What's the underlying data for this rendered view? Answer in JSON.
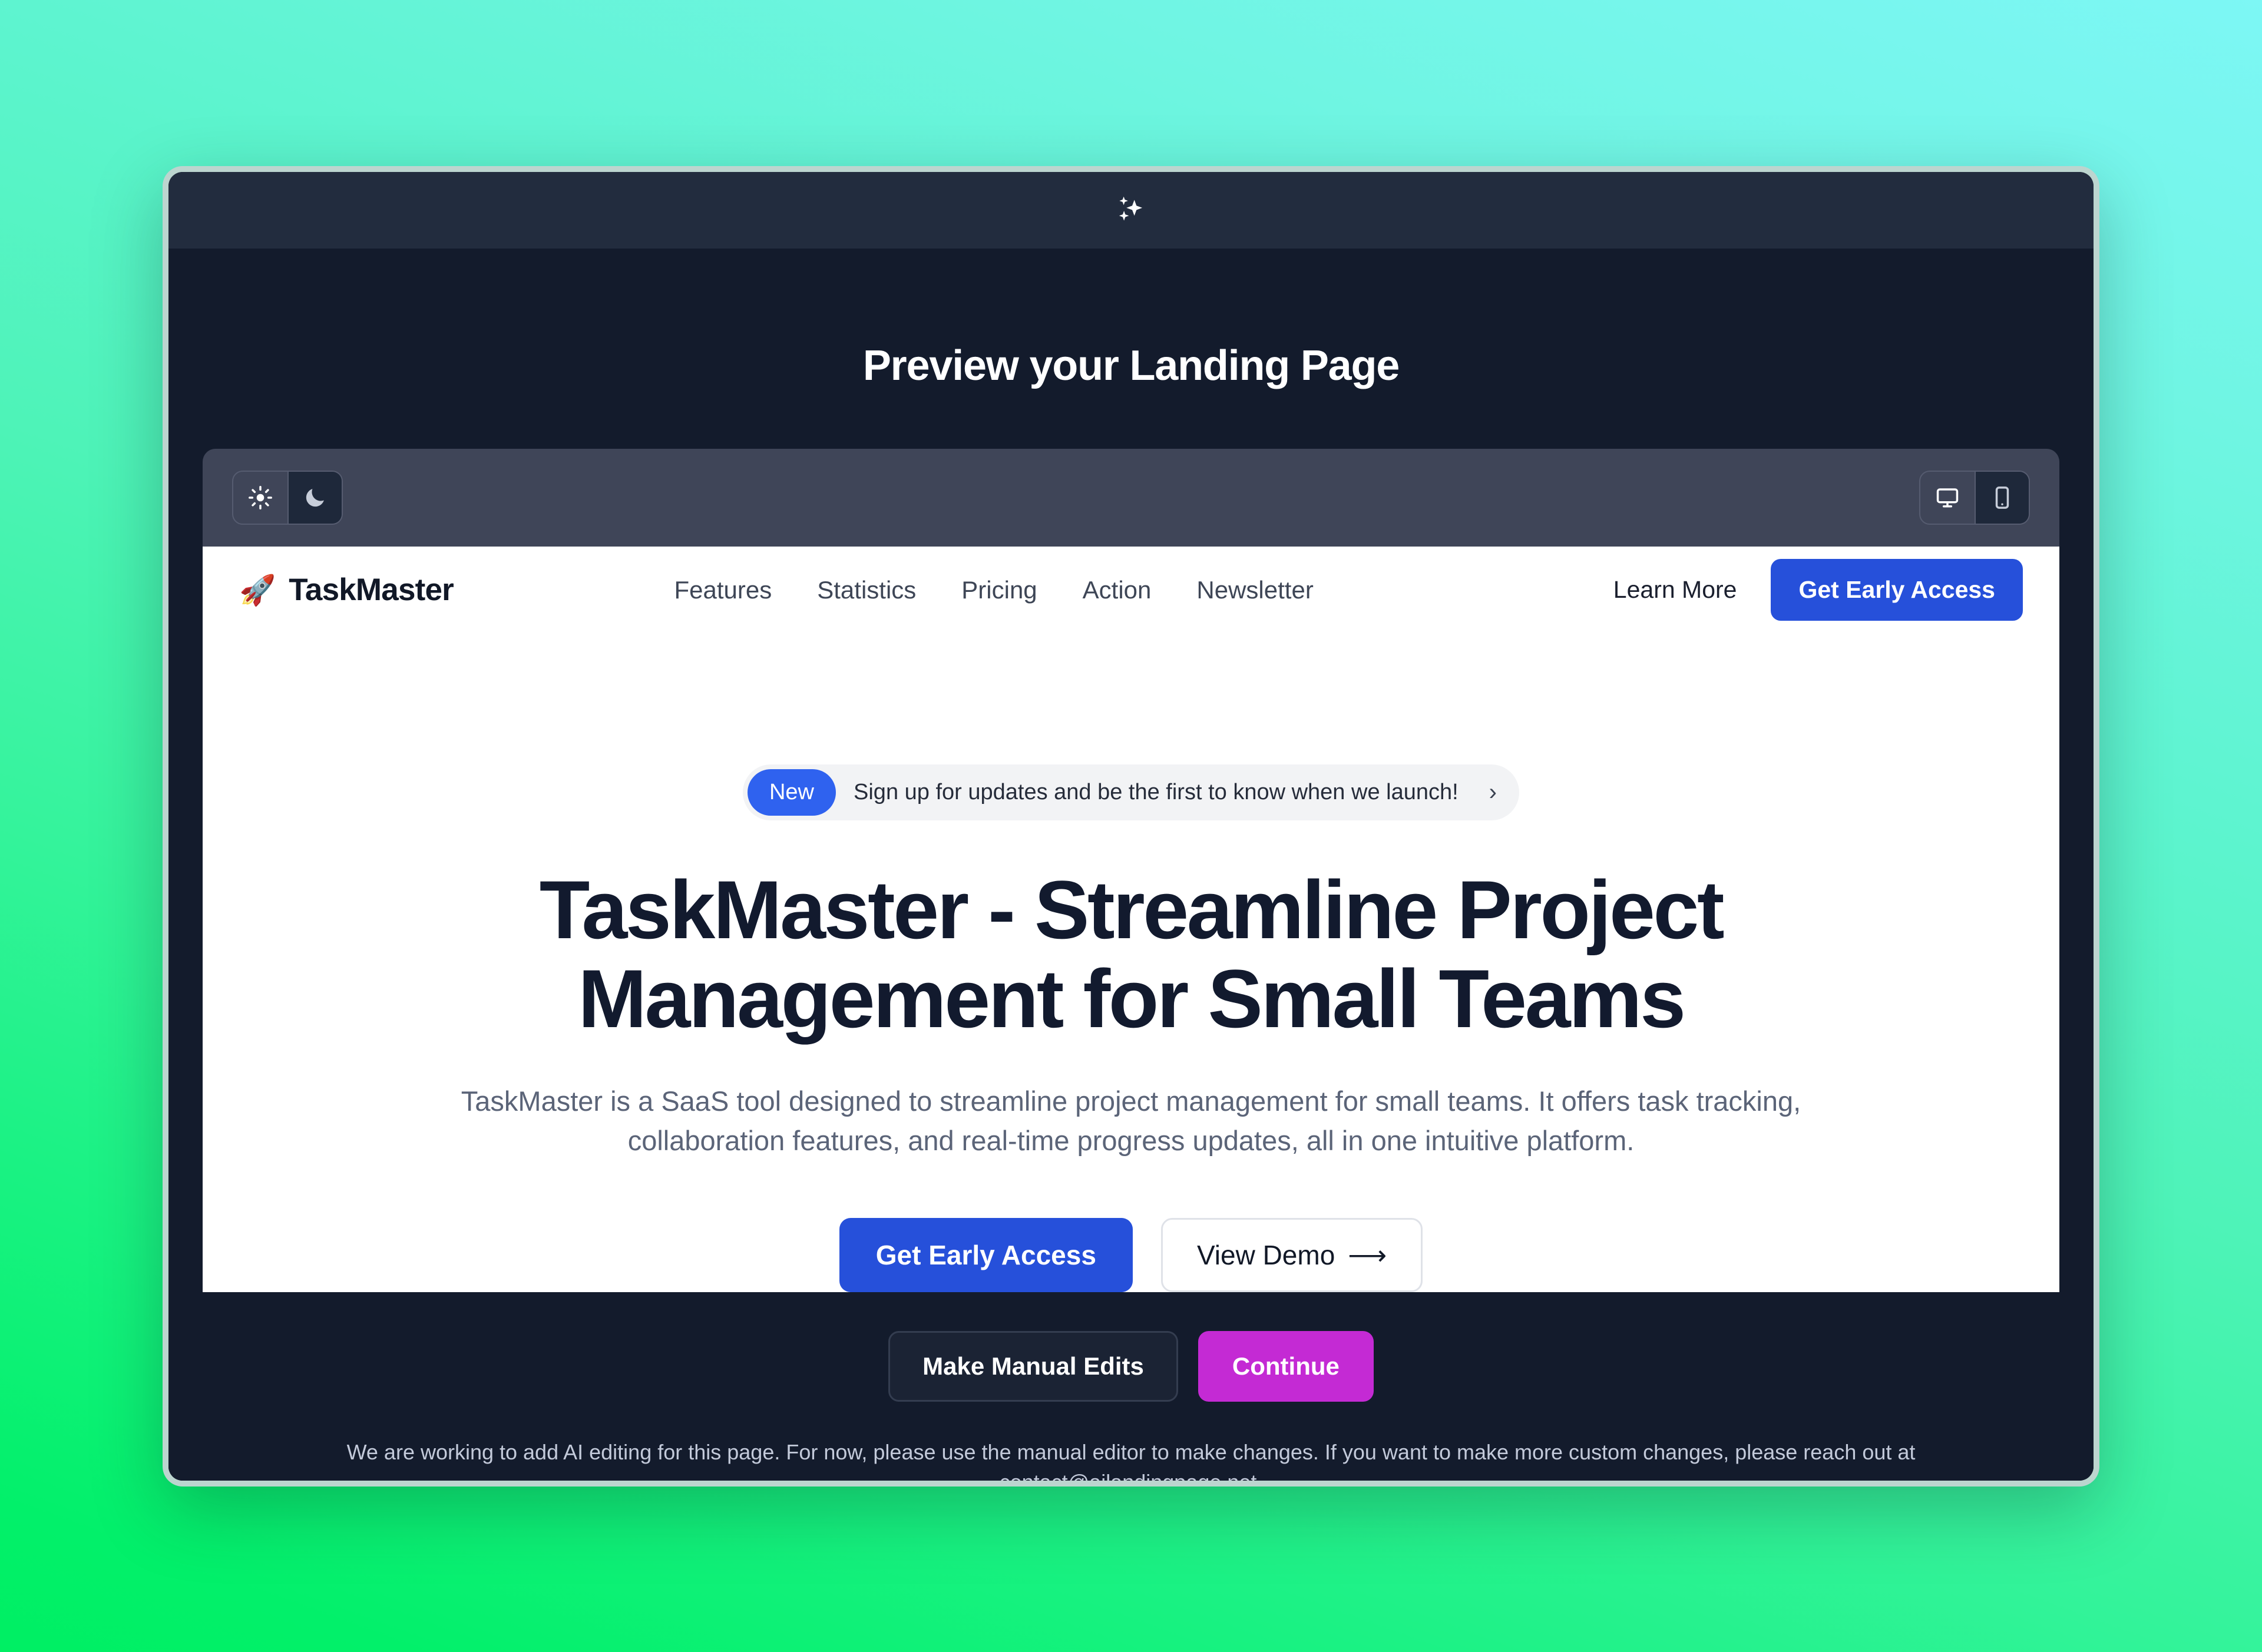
{
  "modal": {
    "header_icon": "sparkles-icon",
    "title": "Preview your Landing Page"
  },
  "preview_toolbar": {
    "theme_group": {
      "light": {
        "icon": "sun-icon",
        "label": "Light",
        "active": false
      },
      "dark": {
        "icon": "moon-icon",
        "label": "Dark",
        "active": true
      }
    },
    "device_group": {
      "desktop": {
        "icon": "monitor-icon",
        "label": "Desktop",
        "active": false
      },
      "mobile": {
        "icon": "mobile-icon",
        "label": "Mobile",
        "active": true
      }
    }
  },
  "landing": {
    "brand": {
      "logo_emoji": "🚀",
      "name": "TaskMaster"
    },
    "nav_links": [
      {
        "label": "Features"
      },
      {
        "label": "Statistics"
      },
      {
        "label": "Pricing"
      },
      {
        "label": "Action"
      },
      {
        "label": "Newsletter"
      }
    ],
    "nav_secondary_label": "Learn More",
    "nav_cta_label": "Get Early Access",
    "hero": {
      "badge_pill": "New",
      "badge_text": "Sign up for updates and be the first to know when we launch!",
      "badge_chevron": "›",
      "title": "TaskMaster - Streamline Project Management for Small Teams",
      "subtitle": "TaskMaster is a SaaS tool designed to streamline project management for small teams. It offers task tracking, collaboration features, and real-time progress updates, all in one intuitive platform.",
      "primary_cta": "Get Early Access",
      "secondary_cta": "View Demo",
      "secondary_cta_arrow": "⟶"
    }
  },
  "footer": {
    "manual_edits_label": "Make Manual Edits",
    "continue_label": "Continue",
    "note": "We are working to add AI editing for this page. For now, please use the manual editor to make changes. If you want to make more custom changes, please reach out at contact@ailandingpage.net."
  },
  "colors": {
    "accent_blue": "#2650da",
    "accent_magenta": "#c42ad4",
    "badge_blue": "#2f62ef",
    "modal_bg": "#131b2c",
    "modal_topbar": "#222c3e",
    "toolbar_bg": "#3f4558",
    "bg_gradient_from": "#7df7f5",
    "bg_gradient_to": "#00ef63"
  }
}
